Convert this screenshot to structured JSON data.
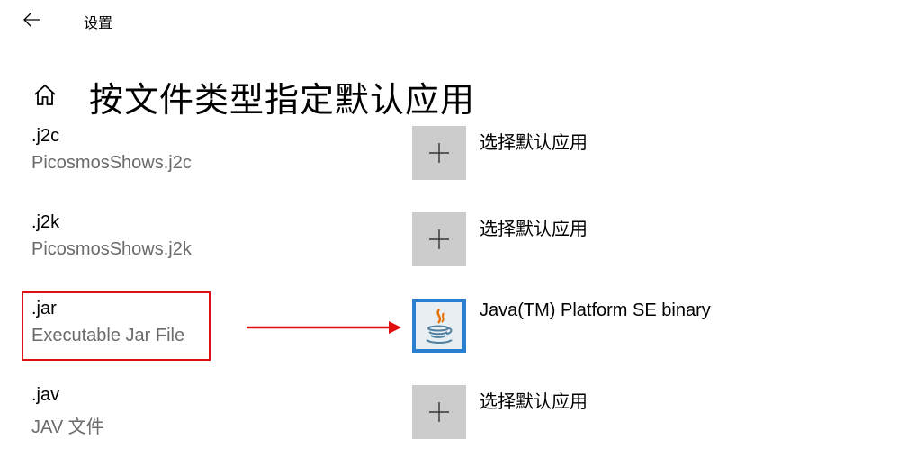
{
  "header": {
    "back_label": "",
    "app_title": "设置"
  },
  "page": {
    "title": "按文件类型指定默认应用"
  },
  "rows": [
    {
      "ext": ".j2c",
      "desc": "PicosmosShows.j2c",
      "app": "选择默认应用",
      "icon": "plus-icon"
    },
    {
      "ext": ".j2k",
      "desc": "PicosmosShows.j2k",
      "app": "选择默认应用",
      "icon": "plus-icon"
    },
    {
      "ext": ".jar",
      "desc": "Executable Jar File",
      "app": "Java(TM) Platform SE binary",
      "icon": "java-icon"
    },
    {
      "ext": ".jav",
      "desc": "JAV 文件",
      "app": "选择默认应用",
      "icon": "plus-icon"
    }
  ],
  "annotation": {
    "color": "#e01010",
    "highlighted_row": ".jar"
  }
}
